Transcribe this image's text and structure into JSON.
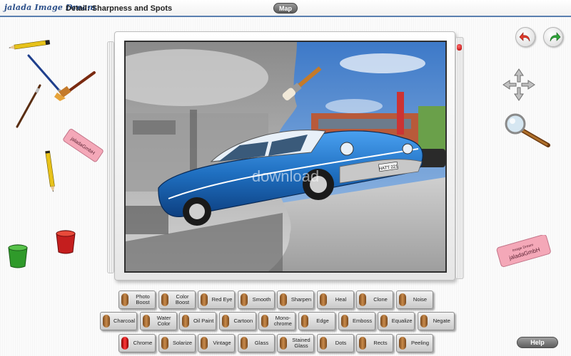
{
  "header": {
    "logo": "jalada Image Dream",
    "detail_title": "Detail: Sharpness and Spots",
    "map_label": "Map"
  },
  "tools": {
    "eraser_left_text": "jaladaGmbH",
    "eraser_right_brand": "Image Dream",
    "eraser_right_text": "jaladaGmbH"
  },
  "photo": {
    "watermark": "download",
    "license_plate": "HATT 221"
  },
  "effects": {
    "row1": [
      {
        "label": "Photo Boost"
      },
      {
        "label": "Color Boost"
      },
      {
        "label": "Red Eye"
      },
      {
        "label": "Smooth"
      },
      {
        "label": "Sharpen"
      },
      {
        "label": "Heal"
      },
      {
        "label": "Clone"
      },
      {
        "label": "Noise"
      }
    ],
    "row2": [
      {
        "label": "Charcoal"
      },
      {
        "label": "Water Color"
      },
      {
        "label": "Oil Paint"
      },
      {
        "label": "Cartoon"
      },
      {
        "label": "Mono-chrome"
      },
      {
        "label": "Edge"
      },
      {
        "label": "Emboss"
      },
      {
        "label": "Equalize"
      },
      {
        "label": "Negate"
      }
    ],
    "row3": [
      {
        "label": "Chrome",
        "active": true
      },
      {
        "label": "Solarize"
      },
      {
        "label": "Vintage"
      },
      {
        "label": "Glass"
      },
      {
        "label": "Stained Glass"
      },
      {
        "label": "Dots"
      },
      {
        "label": "Rects"
      },
      {
        "label": "Peeling"
      }
    ]
  },
  "help_label": "Help",
  "colors": {
    "accent": "#5a7fb0",
    "active_lamp": "#e02020",
    "car_blue": "#1f6fc0"
  }
}
